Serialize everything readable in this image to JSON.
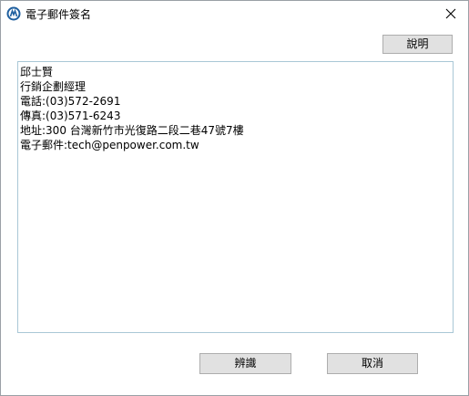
{
  "window": {
    "title": "電子郵件簽名",
    "app_icon": "penpower-logo-icon",
    "close_icon": "close-icon"
  },
  "toolbar": {
    "help_label": "說明"
  },
  "signature": {
    "lines": [
      "邱士賢",
      "行銷企劃經理",
      "電話:(03)572-2691",
      "傳真:(03)571-6243",
      "地址:300 台灣新竹市光復路二段二巷47號7樓",
      "電子郵件:tech@penpower.com.tw"
    ]
  },
  "footer": {
    "ok_label": "辨識",
    "cancel_label": "取消"
  },
  "colors": {
    "button_bg": "#e1e1e1",
    "button_border": "#adadad",
    "textarea_border": "#a9c7d6"
  }
}
